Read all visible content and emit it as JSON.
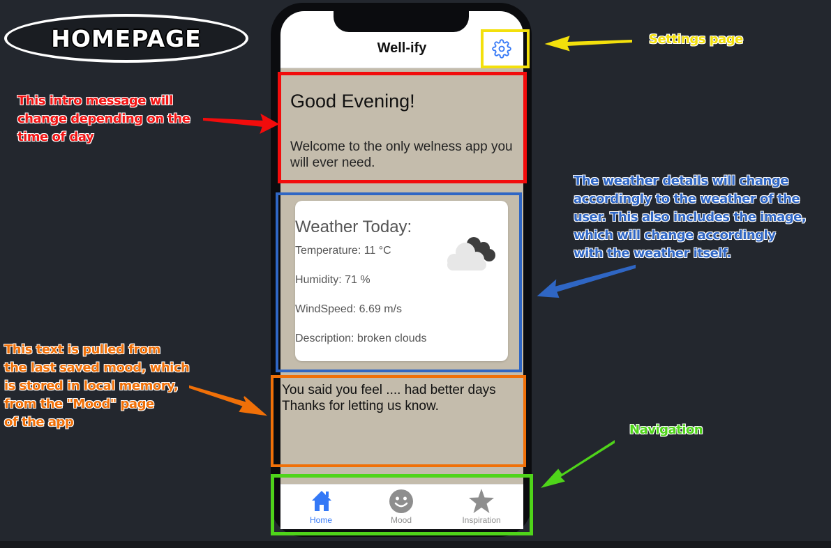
{
  "page_title": "HOMEPAGE",
  "app": {
    "title": "Well-ify",
    "greeting": "Good Evening!",
    "welcome": "Welcome to the only welness app you will ever need.",
    "weather": {
      "title": "Weather Today:",
      "temperature": "Temperature: 11 °C",
      "humidity": "Humidity: 71 %",
      "windspeed": "WindSpeed: 6.69 m/s",
      "description": "Description: broken clouds",
      "icon": "broken-clouds-icon"
    },
    "mood": {
      "line1": "You said you feel .... had better days",
      "line2": "Thanks for letting us know."
    },
    "nav": [
      {
        "label": "Home",
        "icon": "home-icon",
        "active": true
      },
      {
        "label": "Mood",
        "icon": "smiley-icon",
        "active": false
      },
      {
        "label": "Inspiration",
        "icon": "star-icon",
        "active": false
      }
    ]
  },
  "annotations": {
    "settings": "Settings page",
    "intro": [
      "This intro message will",
      "change depending on the",
      "time of day"
    ],
    "weather": [
      "The weather details will change",
      "accordingly to the weather of the",
      "user. This also includes the image,",
      "which will change accordingly",
      "with the weather itself."
    ],
    "mood": [
      "This text is pulled from",
      "the last saved mood, which",
      "is stored in local memory,",
      "from the \"Mood\" page",
      "of the app"
    ],
    "navigation": "Navigation"
  },
  "colors": {
    "background": "#23272e",
    "content_bg": "#c4bcac",
    "accent_blue": "#3478f6",
    "inactive_gray": "#8e8e8e",
    "annotation_red": "#f20c0c",
    "annotation_yellow": "#f3e00c",
    "annotation_blue": "#2f66c4",
    "annotation_orange": "#f07008",
    "annotation_green": "#4fd41a"
  }
}
